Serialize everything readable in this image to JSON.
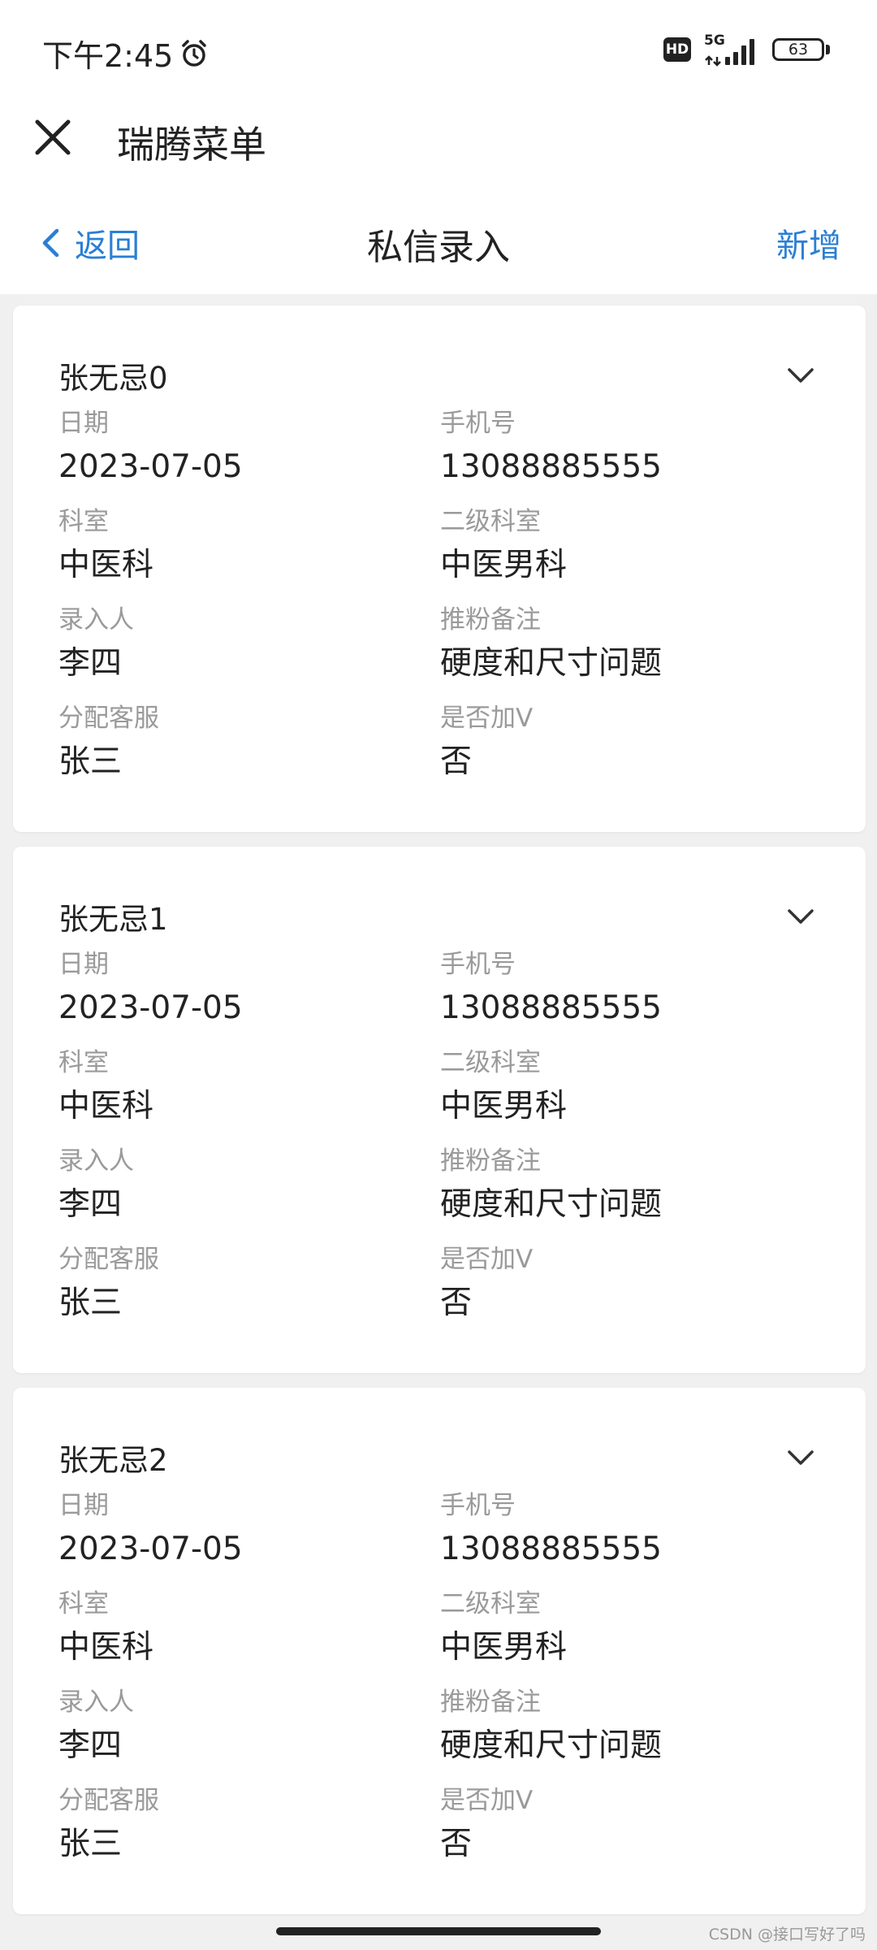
{
  "status": {
    "time": "下午2:45",
    "network": "5G",
    "hd": "HD",
    "battery": "63"
  },
  "app": {
    "title": "瑞腾菜单"
  },
  "nav": {
    "back_label": "返回",
    "title": "私信录入",
    "add_label": "新增"
  },
  "cards": [
    {
      "name": "张无忌0",
      "fields": [
        {
          "label": "日期",
          "value": "2023-07-05"
        },
        {
          "label": "手机号",
          "value": "13088885555"
        },
        {
          "label": "科室",
          "value": "中医科"
        },
        {
          "label": "二级科室",
          "value": "中医男科"
        },
        {
          "label": "录入人",
          "value": "李四"
        },
        {
          "label": "推粉备注",
          "value": "硬度和尺寸问题"
        },
        {
          "label": "分配客服",
          "value": "张三"
        },
        {
          "label": "是否加V",
          "value": "否"
        }
      ]
    },
    {
      "name": "张无忌1",
      "fields": [
        {
          "label": "日期",
          "value": "2023-07-05"
        },
        {
          "label": "手机号",
          "value": "13088885555"
        },
        {
          "label": "科室",
          "value": "中医科"
        },
        {
          "label": "二级科室",
          "value": "中医男科"
        },
        {
          "label": "录入人",
          "value": "李四"
        },
        {
          "label": "推粉备注",
          "value": "硬度和尺寸问题"
        },
        {
          "label": "分配客服",
          "value": "张三"
        },
        {
          "label": "是否加V",
          "value": "否"
        }
      ]
    },
    {
      "name": "张无忌2",
      "fields": [
        {
          "label": "日期",
          "value": "2023-07-05"
        },
        {
          "label": "手机号",
          "value": "13088885555"
        },
        {
          "label": "科室",
          "value": "中医科"
        },
        {
          "label": "二级科室",
          "value": "中医男科"
        },
        {
          "label": "录入人",
          "value": "李四"
        },
        {
          "label": "推粉备注",
          "value": "硬度和尺寸问题"
        },
        {
          "label": "分配客服",
          "value": "张三"
        },
        {
          "label": "是否加V",
          "value": "否"
        }
      ]
    }
  ],
  "watermark": "CSDN @接口写好了吗",
  "colors": {
    "accent": "#2a7fd4",
    "label": "#9a9a9a",
    "background": "#f0f0f0"
  },
  "icons": {
    "close": "close-icon",
    "back": "chevron-left-icon",
    "expand": "chevron-down-icon",
    "alarm": "alarm-icon",
    "signal": "signal-icon",
    "battery": "battery-icon"
  }
}
